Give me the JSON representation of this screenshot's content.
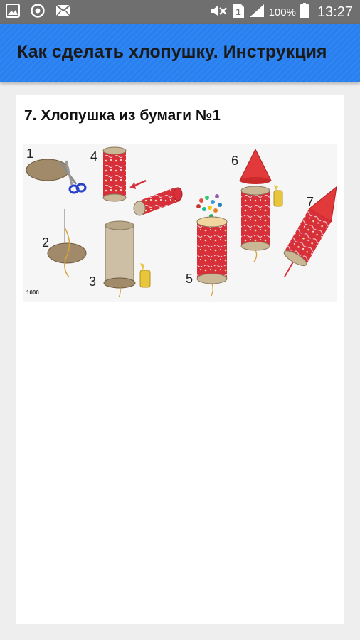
{
  "status_bar": {
    "icons": [
      "image-icon",
      "sync-icon",
      "mail-icon",
      "mute-icon",
      "sim-1-icon",
      "signal-icon",
      "battery-icon"
    ],
    "sim_label": "1",
    "battery_percent": "100%",
    "time": "13:27"
  },
  "app_bar": {
    "title": "Как сделать хлопушку. Инструкция"
  },
  "content": {
    "heading": "7. Хлопушка из бумаги №1",
    "figure": {
      "steps": [
        "1",
        "2",
        "3",
        "4",
        "5",
        "6",
        "7"
      ],
      "watermark": "1000"
    }
  },
  "colors": {
    "status_bar": "#6f6f6f",
    "app_bar": "#2f86f3",
    "tube_red": "#d7303a",
    "cardboard": "#a08a6a"
  }
}
